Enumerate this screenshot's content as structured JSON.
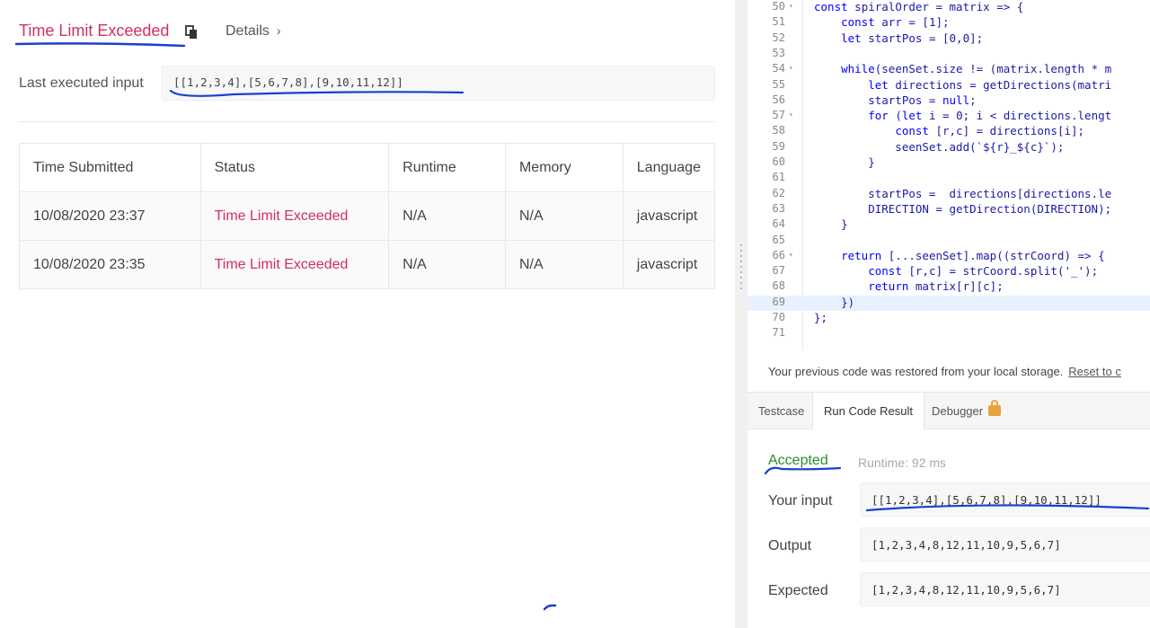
{
  "submission": {
    "status_title": "Time Limit Exceeded",
    "details_label": "Details",
    "last_input_label": "Last executed input",
    "last_input_value": "[[1,2,3,4],[5,6,7,8],[9,10,11,12]]"
  },
  "table": {
    "headers": [
      "Time Submitted",
      "Status",
      "Runtime",
      "Memory",
      "Language"
    ],
    "rows": [
      [
        "10/08/2020 23:37",
        "Time Limit Exceeded",
        "N/A",
        "N/A",
        "javascript"
      ],
      [
        "10/08/2020 23:35",
        "Time Limit Exceeded",
        "N/A",
        "N/A",
        "javascript"
      ]
    ]
  },
  "editor": {
    "highlighted_line": 69,
    "lines": [
      {
        "n": "50",
        "fold": true,
        "text": "const spiralOrder = matrix => {"
      },
      {
        "n": "51",
        "fold": false,
        "text": "    const arr = [1];"
      },
      {
        "n": "52",
        "fold": false,
        "text": "    let startPos = [0,0];"
      },
      {
        "n": "53",
        "fold": false,
        "text": ""
      },
      {
        "n": "54",
        "fold": true,
        "text": "    while(seenSet.size != (matrix.length * m"
      },
      {
        "n": "55",
        "fold": false,
        "text": "        let directions = getDirections(matri"
      },
      {
        "n": "56",
        "fold": false,
        "text": "        startPos = null;"
      },
      {
        "n": "57",
        "fold": true,
        "text": "        for (let i = 0; i < directions.lengt"
      },
      {
        "n": "58",
        "fold": false,
        "text": "            const [r,c] = directions[i];"
      },
      {
        "n": "59",
        "fold": false,
        "text": "            seenSet.add(`${r}_${c}`);"
      },
      {
        "n": "60",
        "fold": false,
        "text": "        }"
      },
      {
        "n": "61",
        "fold": false,
        "text": ""
      },
      {
        "n": "62",
        "fold": false,
        "text": "        startPos =  directions[directions.le"
      },
      {
        "n": "63",
        "fold": false,
        "text": "        DIRECTION = getDirection(DIRECTION);"
      },
      {
        "n": "64",
        "fold": false,
        "text": "    }"
      },
      {
        "n": "65",
        "fold": false,
        "text": ""
      },
      {
        "n": "66",
        "fold": true,
        "text": "    return [...seenSet].map((strCoord) => {"
      },
      {
        "n": "67",
        "fold": false,
        "text": "        const [r,c] = strCoord.split('_');"
      },
      {
        "n": "68",
        "fold": false,
        "text": "        return matrix[r][c];"
      },
      {
        "n": "69",
        "fold": false,
        "text": "    })"
      },
      {
        "n": "70",
        "fold": false,
        "text": "};"
      },
      {
        "n": "71",
        "fold": false,
        "text": ""
      }
    ]
  },
  "restore": {
    "message": "Your previous code was restored from your local storage.",
    "reset_label": "Reset to c"
  },
  "tabs": [
    {
      "label": "Testcase",
      "active": false
    },
    {
      "label": "Run Code Result",
      "active": true
    },
    {
      "label": "Debugger",
      "active": false,
      "icon": "lock-icon"
    }
  ],
  "result": {
    "status": "Accepted",
    "runtime": "Runtime: 92 ms",
    "your_input_label": "Your input",
    "your_input_value": "[[1,2,3,4],[5,6,7,8],[9,10,11,12]]",
    "output_label": "Output",
    "output_value": "[1,2,3,4,8,12,11,10,9,5,6,7]",
    "expected_label": "Expected",
    "expected_value": "[1,2,3,4,8,12,11,10,9,5,6,7]"
  },
  "colors": {
    "error": "#d1305c",
    "success": "#2e8b2e",
    "annotation_ink": "#1a3fcf"
  }
}
